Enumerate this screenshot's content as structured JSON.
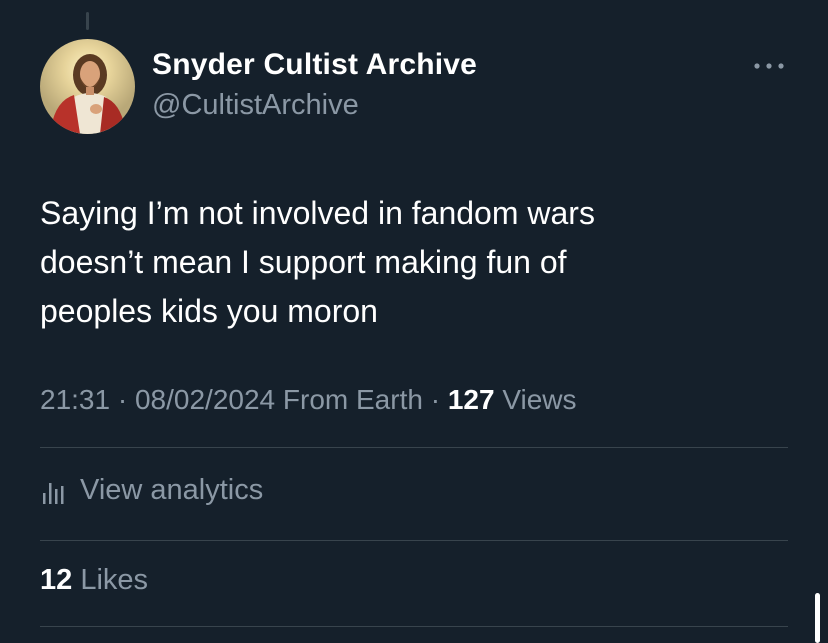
{
  "author": {
    "display_name": "Snyder Cultist Archive",
    "handle": "@CultistArchive",
    "avatar_icon": "religious-portrait-avatar"
  },
  "tweet": {
    "text": "Saying I’m not involved in fandom wars\ndoesn’t mean I support making fun of\npeoples kids you moron"
  },
  "meta": {
    "time": "21:31",
    "separator1": " · ",
    "date": "08/02/2024",
    "location": "From Earth",
    "separator2": " · ",
    "views_count": "127",
    "views_label": "Views"
  },
  "analytics": {
    "label": "View analytics",
    "icon": "bar-chart-icon"
  },
  "likes": {
    "count": "12",
    "label": "Likes"
  },
  "colors": {
    "background": "#15202b",
    "primary_text": "#ffffff",
    "secondary_text": "#8b98a5",
    "divider": "#38444d"
  }
}
